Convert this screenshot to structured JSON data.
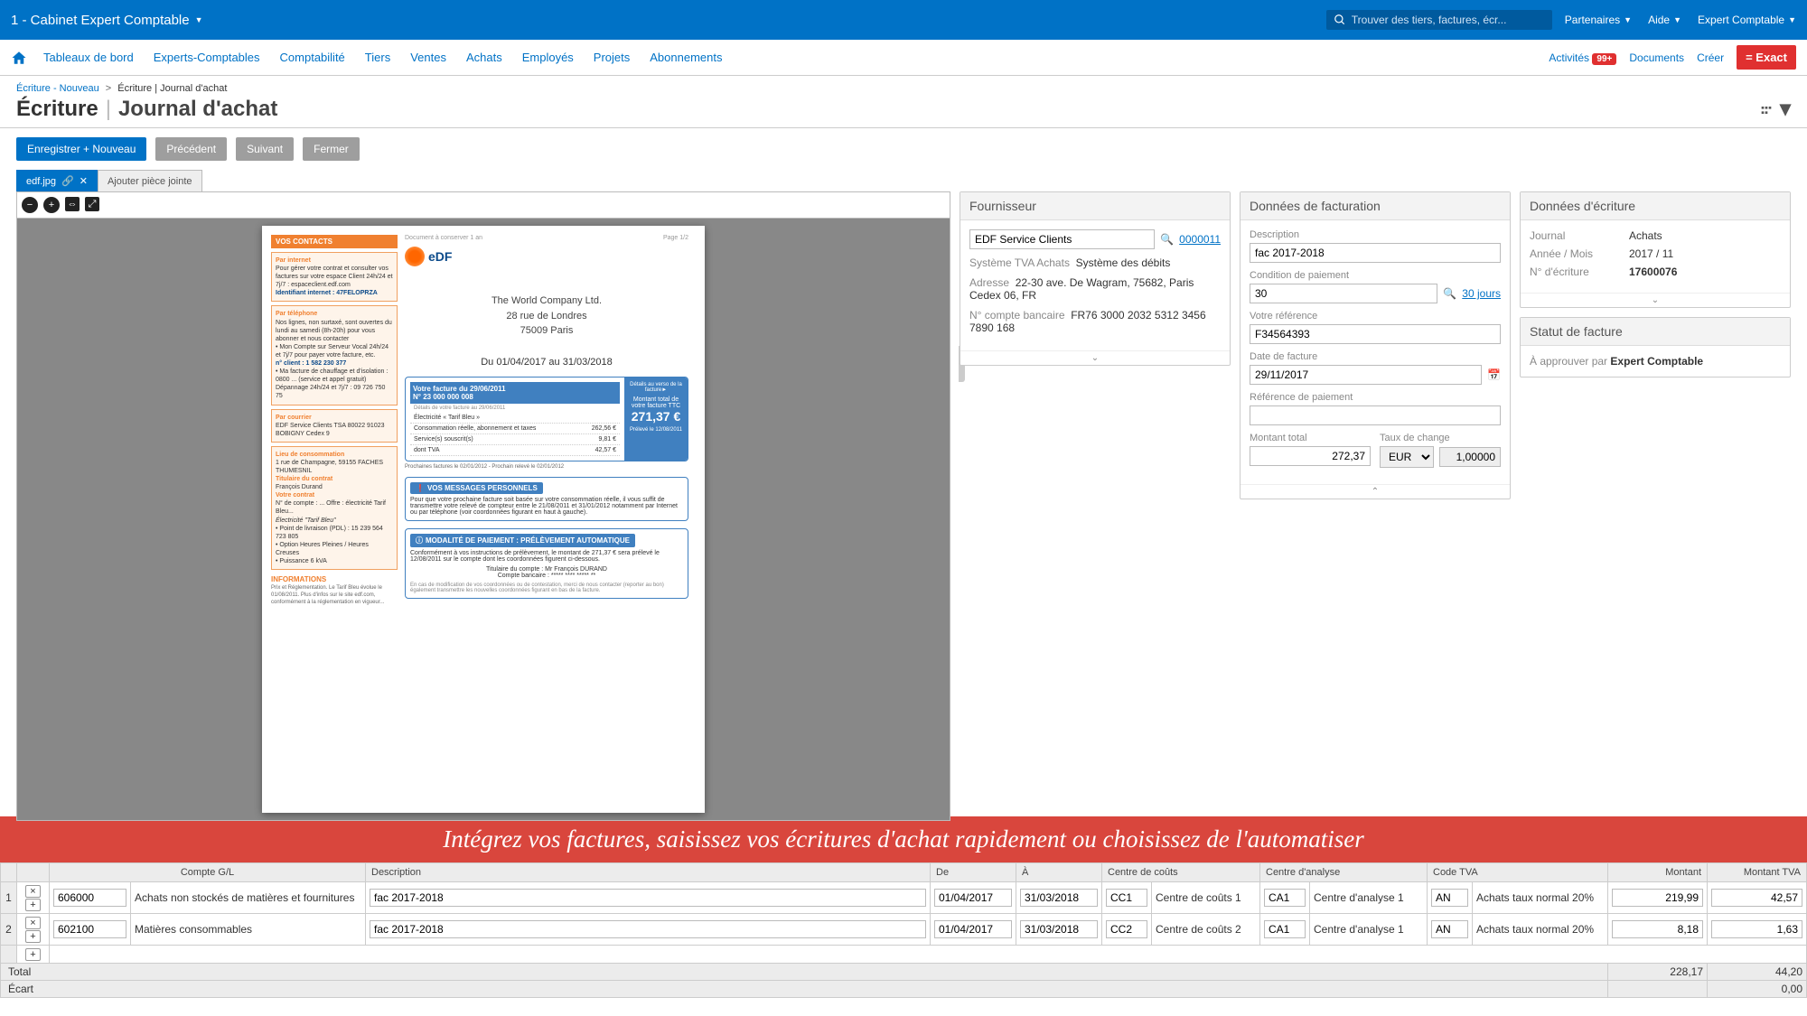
{
  "header": {
    "company": "1 - Cabinet Expert Comptable",
    "search_placeholder": "Trouver des tiers, factures, écr...",
    "partners": "Partenaires",
    "help": "Aide",
    "user": "Expert Comptable"
  },
  "nav": {
    "items": [
      "Tableaux de bord",
      "Experts-Comptables",
      "Comptabilité",
      "Tiers",
      "Ventes",
      "Achats",
      "Employés",
      "Projets",
      "Abonnements"
    ],
    "activities": "Activités",
    "badge": "99+",
    "documents": "Documents",
    "create": "Créer",
    "brand": "Exact"
  },
  "breadcrumb": {
    "a": "Écriture - Nouveau",
    "b": "Écriture | Journal d'achat"
  },
  "title": {
    "main": "Écriture",
    "sub": "Journal d'achat"
  },
  "actions": {
    "save_new": "Enregistrer + Nouveau",
    "prev": "Précédent",
    "next": "Suivant",
    "close": "Fermer"
  },
  "tabs": {
    "file": "edf.jpg",
    "add": "Ajouter pièce jointe"
  },
  "doc": {
    "header_hint": "Document à conserver 1 an",
    "page": "Page 1/2",
    "contacts_title": "VOS CONTACTS",
    "by_internet": "Par internet",
    "internet_text": "Pour gérer votre contrat et consulter vos factures sur votre espace Client 24h/24 et 7j/7 : espaceclient.edf.com",
    "id_internet": "Identifiant internet : 47FELOPRZA",
    "by_phone": "Par téléphone",
    "phone_text": "Nos lignes, non surtaxé, sont ouvertes du lundi au samedi (8h-20h) pour vous abonner et nous contacter",
    "phone_line1": "• Mon Compte sur Serveur Vocal 24h/24 et 7j/7 pour payer votre facture, etc.",
    "n_client": "n° client : 1 582 230 377",
    "urgence": "• Ma facture de chauffage et d'isolation : 0800 ... (service et appel gratuit)",
    "depannage": "Dépannage 24h/24 et 7j/7 : 09 726 750 75",
    "by_mail": "Par courrier",
    "mail_text": "EDF Service Clients\nTSA 80022\n91023 BOBIGNY Cedex 9",
    "lieu_title": "Lieu de consommation",
    "lieu_text": "1 rue de Champagne,\n59155 FACHES THUMESNIL",
    "titulaire": "Titulaire du contrat",
    "titulaire_name": "François Durand",
    "contrat": "Votre contrat",
    "contrat_text": "N° de compte : ...\nOffre : électricité Tarif Bleu...",
    "elec": "Électricité \"Tarif Bleu\"",
    "livraison": "• Point de livraison (PDL) : 15 239 564 723 805",
    "option": "• Option Heures Pleines / Heures Creuses",
    "puissance": "• Puissance 6 kVA",
    "info_title": "INFORMATIONS",
    "info_text": "Prix et Réglementation. Le Tarif Bleu évolue le 01/08/2011. Plus d'infos sur le site edf.com, conformément à la réglementation en vigueur...",
    "company": "The World Company Ltd.",
    "street": "28 rue de Londres",
    "city": "75009 Paris",
    "period": "Du 01/04/2017 au 31/03/2018",
    "inv_title": "Votre facture du 29/06/2011",
    "inv_no": "N° 23 000 000 008",
    "inv_detail": "Détails de votre facture au 29/06/2011",
    "inv_elec": "Électricité « Tarif Bleu »",
    "inv_conso": "Consommation réelle, abonnement et taxes",
    "inv_services": "Service(s) souscrit(s)",
    "inv_tva": "dont TVA",
    "amt_262": "262,56 €",
    "amt_981": "9,81 €",
    "amt_4257": "42,57 €",
    "total_label": "Montant total de votre facture TTC",
    "total_amt": "271,37 €",
    "prelev": "Prélevé le 12/08/2011",
    "prochaines": "Prochaines factures le 02/01/2012 - Prochain relevé le 02/01/2012",
    "montant_detail": "Détails au verso de la facture►",
    "msg_title": "VOS MESSAGES PERSONNELS",
    "msg_text": "Pour que votre prochaine facture soit basée sur votre consommation réelle, il vous suffit de transmettre votre relevé de compteur entre le 21/08/2011 et 31/01/2012 notamment par Internet ou par téléphone (voir coordonnées figurant en haut à gauche).",
    "pay_title": "MODALITÉ DE PAIEMENT : PRÉLÈVEMENT AUTOMATIQUE",
    "pay_text": "Conformément à vos instructions de prélèvement, le montant de 271,37 € sera prélevé le 12/08/2011 sur le compte dont les coordonnées figurent ci-dessous.",
    "titulaire_compte": "Titulaire du compte : Mr François DURAND",
    "compte_banc": "Compte bancaire : ***** **** ***** **",
    "modif": "En cas de modification de vos coordonnées ou de contestation, merci de nous contacter (reporter au bon) également transmettre les nouvelles coordonnées figurant en bas de la facture."
  },
  "supplier": {
    "title": "Fournisseur",
    "name": "EDF Service Clients",
    "code": "0000011",
    "vat_system_label": "Système TVA Achats",
    "vat_system_value": "Système des débits",
    "address_label": "Adresse",
    "address_value": "22-30 ave. De Wagram, 75682, Paris Cedex 06, FR",
    "bank_label": "N° compte bancaire",
    "bank_value": "FR76 3000 2032 5312 3456 7890 168"
  },
  "billing": {
    "title": "Données de facturation",
    "desc_label": "Description",
    "desc_value": "fac 2017-2018",
    "payterm_label": "Condition de paiement",
    "payterm_value": "30",
    "payterm_link": "30 jours",
    "ref_label": "Votre référence",
    "ref_value": "F34564393",
    "date_label": "Date de facture",
    "date_value": "29/11/2017",
    "payref_label": "Référence de paiement",
    "payref_value": "",
    "total_label": "Montant total",
    "total_value": "272,37",
    "rate_label": "Taux de change",
    "rate_currency": "EUR",
    "rate_value": "1,00000"
  },
  "entry": {
    "title": "Données d'écriture",
    "journal_label": "Journal",
    "journal_value": "Achats",
    "period_label": "Année / Mois",
    "period_value": "2017 / 11",
    "number_label": "N° d'écriture",
    "number_value": "17600076"
  },
  "status": {
    "title": "Statut de facture",
    "approve_label": "À approuver par",
    "approve_value": "Expert Comptable"
  },
  "banner": "Intégrez vos factures, saisissez vos écritures d'achat rapidement ou choisissez de l'automatiser",
  "table": {
    "headers": {
      "gl": "Compte G/L",
      "desc": "Description",
      "from": "De",
      "to": "À",
      "cc": "Centre de coûts",
      "ca": "Centre d'analyse",
      "vat": "Code TVA",
      "amt": "Montant",
      "vatamt": "Montant TVA"
    },
    "rows": [
      {
        "idx": "1",
        "gl": "606000",
        "gl_desc": "Achats non stockés de matières et fournitures",
        "desc": "fac 2017-2018",
        "from": "01/04/2017",
        "to": "31/03/2018",
        "cc": "CC1",
        "cc_desc": "Centre de coûts 1",
        "ca": "CA1",
        "ca_desc": "Centre d'analyse 1",
        "vat": "AN",
        "vat_desc": "Achats taux normal 20%",
        "amt": "219,99",
        "vatamt": "42,57"
      },
      {
        "idx": "2",
        "gl": "602100",
        "gl_desc": "Matières consommables",
        "desc": "fac 2017-2018",
        "from": "01/04/2017",
        "to": "31/03/2018",
        "cc": "CC2",
        "cc_desc": "Centre de coûts 2",
        "ca": "CA1",
        "ca_desc": "Centre d'analyse 1",
        "vat": "AN",
        "vat_desc": "Achats taux normal 20%",
        "amt": "8,18",
        "vatamt": "1,63"
      }
    ],
    "total_label": "Total",
    "total_amt": "228,17",
    "total_vat": "44,20",
    "diff_label": "Écart",
    "diff_amt": "0,00"
  }
}
